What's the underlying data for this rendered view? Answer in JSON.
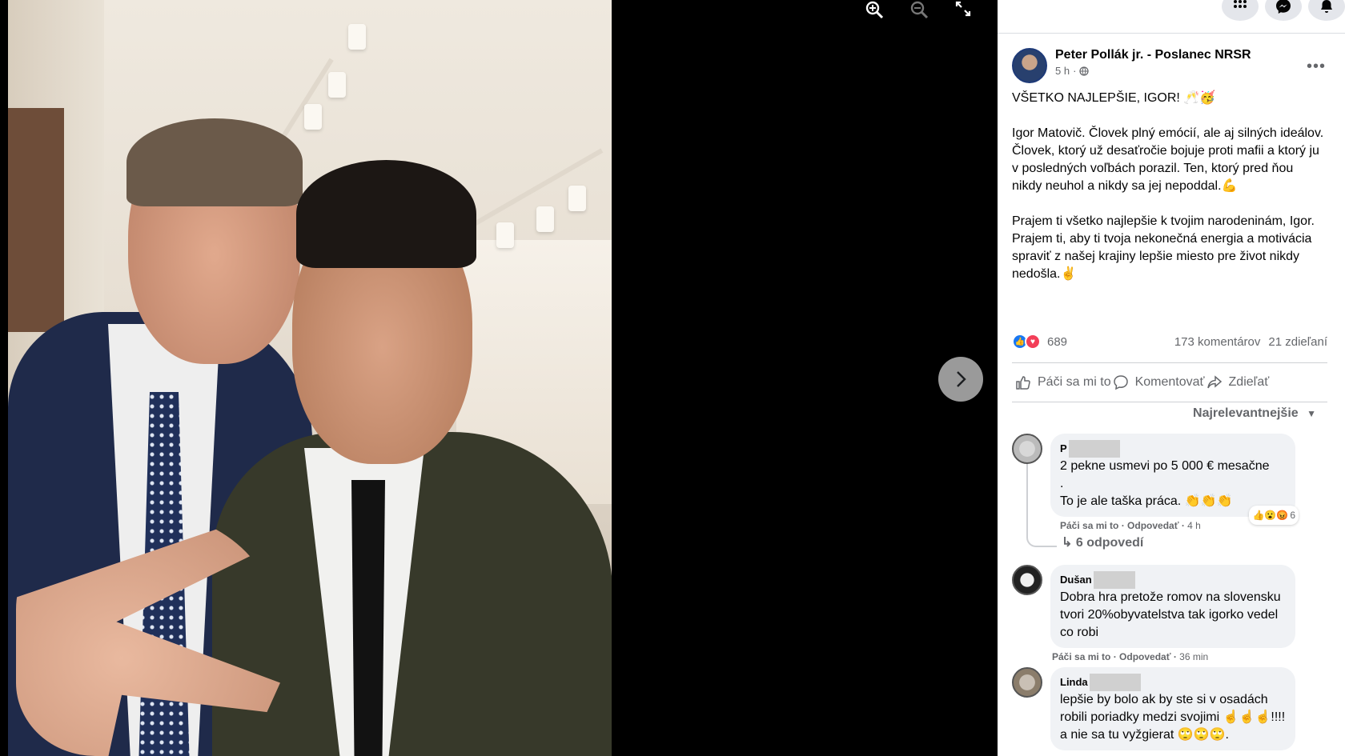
{
  "viewer": {
    "controls": {
      "zoom_in_icon": "zoom-in-icon",
      "zoom_out_icon": "zoom-out-icon",
      "fullscreen_icon": "fullscreen-icon"
    },
    "next_icon": "chevron-right-icon"
  },
  "topbar": {
    "icons": [
      "apps-grid-icon",
      "messenger-icon",
      "notifications-icon"
    ]
  },
  "post": {
    "author": "Peter Pollák jr. - Poslanec NRSR",
    "time": "5 h",
    "separator": "·",
    "privacy_icon": "globe-icon",
    "headline": "VŠETKO NAJLEPŠIE, IGOR! 🥂🥳",
    "paragraph1": "Igor Matovič. Človek plný emócií, ale aj silných ideálov. Človek, ktorý už desaťročie bojuje proti mafii a ktorý ju v posledných voľbách porazil. Ten, ktorý pred ňou nikdy neuhol a nikdy sa jej nepoddal.💪",
    "paragraph2": "Prajem ti všetko najlepšie k tvojim narodeninám, Igor. Prajem ti, aby ti tvoja nekonečná energia a motivácia spraviť z našej krajiny lepšie miesto pre život nikdy nedošla.✌️"
  },
  "stats": {
    "reactions": "689",
    "comments": "173 komentárov",
    "shares": "21 zdieľaní",
    "reaction_types": [
      "like",
      "love"
    ]
  },
  "actions": {
    "like": "Páči sa mi to",
    "comment": "Komentovať",
    "share": "Zdieľať"
  },
  "sort_label": "Najrelevantnejšie",
  "comments": [
    {
      "name": "P",
      "line1": "2 pekne usmevi po 5 000 € mesačne",
      "line2": ".",
      "line3": "To je ale taška práca. 👏👏👏",
      "like_link": "Páči sa mi to",
      "reply_link": "Odpovedať",
      "time": "4 h",
      "reaction_count": "6",
      "reactions_emoji": "👍😮😡",
      "replies": "6 odpovedí"
    },
    {
      "name": "Dušan",
      "text": "Dobra hra pretože romov na slovensku tvori 20%obyvatelstva tak igorko vedel co robi",
      "like_link": "Páči sa mi to",
      "reply_link": "Odpovedať",
      "time": "36 min"
    },
    {
      "name": "Linda",
      "text": "lepšie by bolo ak by ste si v osadách robili poriadky medzi svojimi ☝️☝️☝️!!!! a nie sa tu vyžgierat 🙄🙄🙄."
    }
  ]
}
